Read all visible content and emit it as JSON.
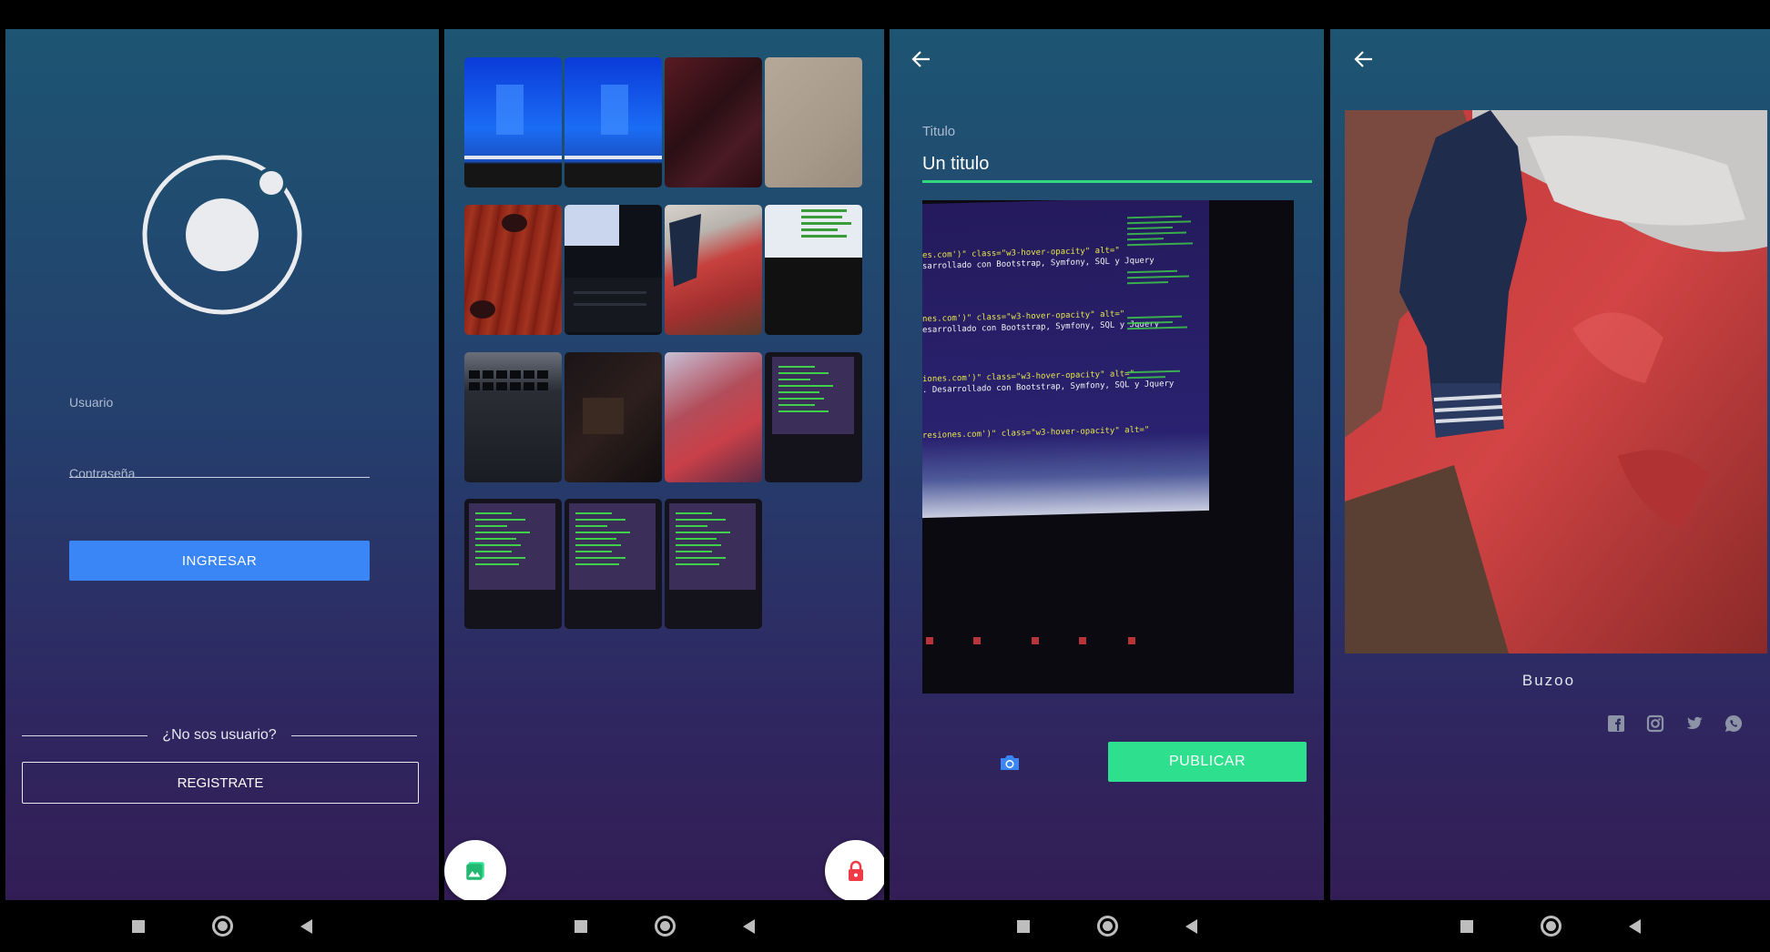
{
  "colors": {
    "primary_button": "#3b86f7",
    "accent_green": "#2ee08d",
    "fab_red": "#ef3b45",
    "fab_green": "#2ee08d",
    "camera_blue": "#3b86f7"
  },
  "login": {
    "logo_icon": "ionic-logo",
    "username_label": "Usuario",
    "username_value": "",
    "password_label": "Contraseña",
    "password_value": "",
    "login_button": "INGRESAR",
    "no_user_text": "¿No sos usuario?",
    "register_button": "REGISTRATE"
  },
  "gallery": {
    "photos": [
      "blue-screen-photo",
      "blue-screen-photo-2",
      "red-fabric-photo",
      "beige-wall-photo",
      "red-wood-floor-photo",
      "dark-monitor-keyboard-photo",
      "red-jacket-on-bed-photo",
      "code-monitor-photo",
      "laptop-keyboard-photo",
      "dark-desk-photo",
      "pink-clothes-photo",
      "code-screen-photo",
      "code-screen-photo-2",
      "code-screen-photo-3",
      "code-screen-photo-4"
    ],
    "fab_left_icon": "gallery-icon",
    "fab_right_icon": "lock-icon"
  },
  "publish": {
    "back_icon": "arrow-back-icon",
    "title_label": "Titulo",
    "title_value": "Un titulo",
    "preview_photo": "monitor-code-photo",
    "screen_lines": [
      "es.com')\" class=\"w3-hover-opacity\" alt=\"",
      "sarrollado con Bootstrap, Symfony, SQL y Jquery",
      "nes.com')\" class=\"w3-hover-opacity\" alt=\"",
      "esarrollado con Bootstrap, Symfony, SQL y Jquery",
      "iones.com')\" class=\"w3-hover-opacity\" alt=\"",
      ". Desarrollado con Bootstrap, Symfony, SQL y Jquery",
      "resiones.com')\" class=\"w3-hover-opacity\" alt=\""
    ],
    "camera_icon": "camera-icon",
    "publish_button": "PUBLICAR"
  },
  "detail": {
    "back_icon": "arrow-back-icon",
    "photo": "jacket-on-bed-photo",
    "caption": "Buzoo",
    "social_icons": [
      "facebook-icon",
      "instagram-icon",
      "twitter-icon",
      "whatsapp-icon"
    ]
  }
}
